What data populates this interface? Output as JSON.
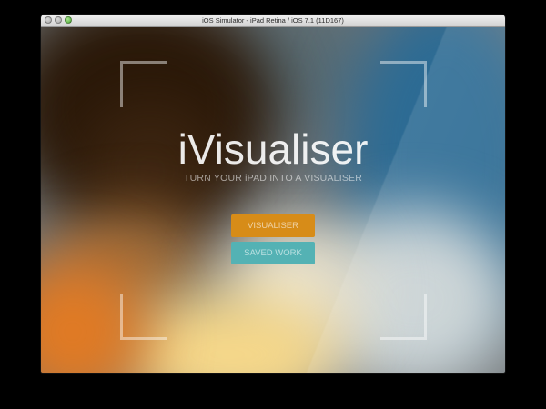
{
  "window": {
    "title": "iOS Simulator - iPad Retina / iOS 7.1 (11D167)"
  },
  "app": {
    "title": "iVisualiser",
    "tagline": "TURN YOUR iPAD INTO A VISUALISER"
  },
  "buttons": {
    "visualiser_label": "VISUALISER",
    "saved_work_label": "SAVED WORK"
  },
  "colors": {
    "visualiser_button": "#d78c18",
    "saved_work_button": "#54b2b4",
    "zoom_button": "#4caa35"
  },
  "icons": {
    "viewfinder_corners": "viewfinder-corner-icon"
  }
}
